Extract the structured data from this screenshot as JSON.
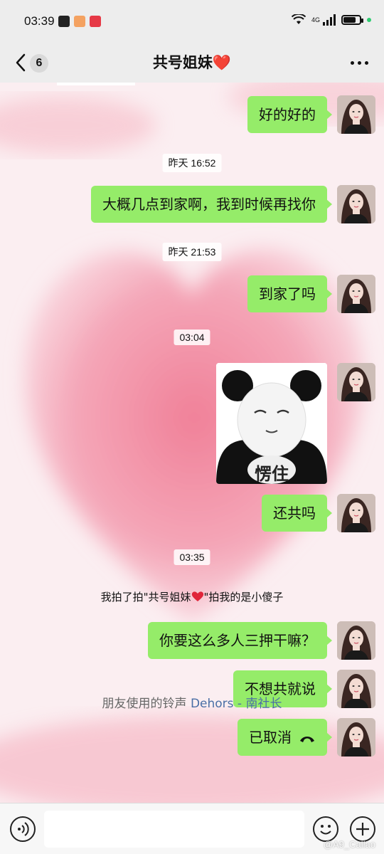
{
  "status_bar": {
    "time": "03:39",
    "network": "4G",
    "battery_level": 0.75
  },
  "nav": {
    "unread_count": "6",
    "title": "共号姐妹❤️"
  },
  "messages": [
    {
      "type": "text",
      "text": "好的好的"
    },
    {
      "type": "time",
      "text": "昨天 16:52"
    },
    {
      "type": "text",
      "text": "大概几点到家啊，我到时候再找你"
    },
    {
      "type": "time",
      "text": "昨天 21:53"
    },
    {
      "type": "text",
      "text": "到家了吗"
    },
    {
      "type": "time",
      "text": "03:04"
    },
    {
      "type": "sticker",
      "caption": "愣住"
    },
    {
      "type": "text",
      "text": "还共吗"
    },
    {
      "type": "time",
      "text": "03:35"
    },
    {
      "type": "system",
      "prefix": "我拍了拍\"共号姐妹",
      "suffix": "\"拍我的是小傻子"
    },
    {
      "type": "text",
      "text": "你要这么多人三押干嘛？"
    },
    {
      "type": "text",
      "text": "不想共就说"
    },
    {
      "type": "text",
      "text": "已取消"
    }
  ],
  "ringtone": {
    "prefix": "朋友使用的铃声 ",
    "song": "Dehors - 南社长"
  },
  "input": {
    "placeholder": ""
  },
  "watermark": "@A9_Callao",
  "colors": {
    "bubble": "#95ec69",
    "bar_bg": "#ededed",
    "heart_pink": "#f08ca0"
  }
}
